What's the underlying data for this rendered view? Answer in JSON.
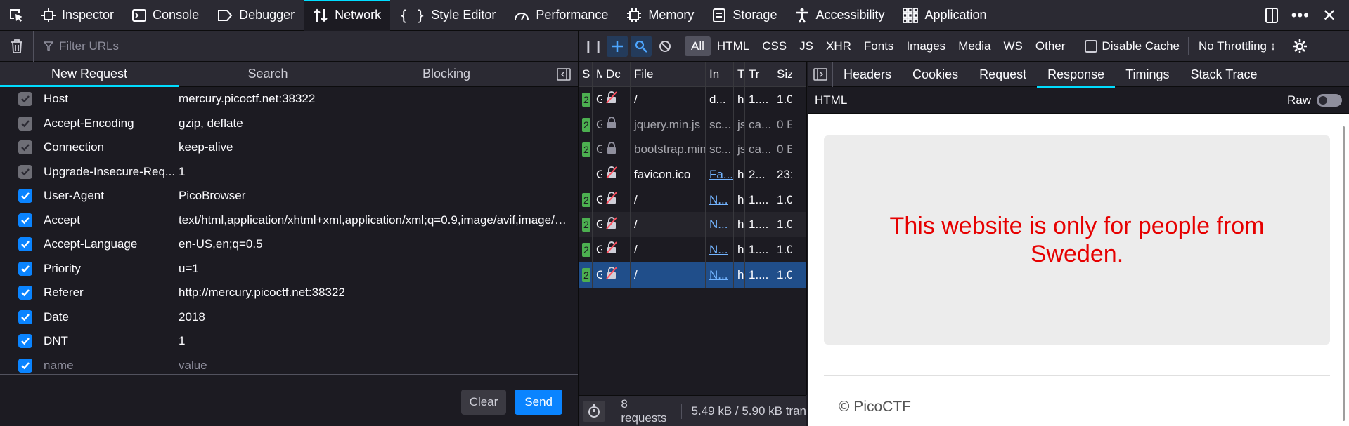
{
  "toolbar": {
    "tabs": [
      {
        "label": "Inspector",
        "icon": "inspector-icon"
      },
      {
        "label": "Console",
        "icon": "console-icon"
      },
      {
        "label": "Debugger",
        "icon": "debugger-icon"
      },
      {
        "label": "Network",
        "icon": "network-icon"
      },
      {
        "label": "Style Editor",
        "icon": "style-editor-icon"
      },
      {
        "label": "Performance",
        "icon": "performance-icon"
      },
      {
        "label": "Memory",
        "icon": "memory-icon"
      },
      {
        "label": "Storage",
        "icon": "storage-icon"
      },
      {
        "label": "Accessibility",
        "icon": "accessibility-icon"
      },
      {
        "label": "Application",
        "icon": "application-icon"
      }
    ],
    "active_tab": "Network",
    "accent": "#00ddff"
  },
  "left": {
    "filter_placeholder": "Filter URLs",
    "subtabs": [
      "New Request",
      "Search",
      "Blocking"
    ],
    "headers": [
      {
        "name": "Host",
        "value": "mercury.picoctf.net:38322",
        "state": "dim"
      },
      {
        "name": "Accept-Encoding",
        "value": "gzip, deflate",
        "state": "dim"
      },
      {
        "name": "Connection",
        "value": "keep-alive",
        "state": "dim"
      },
      {
        "name": "Upgrade-Insecure-Req...",
        "value": "1",
        "state": "dim"
      },
      {
        "name": "User-Agent",
        "value": "PicoBrowser",
        "state": "on"
      },
      {
        "name": "Accept",
        "value": "text/html,application/xhtml+xml,application/xml;q=0.9,image/avif,image/w...",
        "state": "on"
      },
      {
        "name": "Accept-Language",
        "value": "en-US,en;q=0.5",
        "state": "on"
      },
      {
        "name": "Priority",
        "value": "u=1",
        "state": "on"
      },
      {
        "name": "Referer",
        "value": "http://mercury.picoctf.net:38322",
        "state": "on"
      },
      {
        "name": "Date",
        "value": "2018",
        "state": "on"
      },
      {
        "name": "DNT",
        "value": "1",
        "state": "on"
      },
      {
        "name": "name",
        "value": "value",
        "state": "on",
        "placeholder": true
      }
    ],
    "clear_label": "Clear",
    "send_label": "Send"
  },
  "midbar": {
    "types": [
      "All",
      "HTML",
      "CSS",
      "JS",
      "XHR",
      "Fonts",
      "Images",
      "Media",
      "WS",
      "Other"
    ],
    "active_type": "All",
    "disable_cache_label": "Disable Cache",
    "throttling_label": "No Throttling ↕"
  },
  "list": {
    "columns": [
      "S",
      "M",
      "Dc",
      "File",
      "In",
      "T",
      "Tr",
      "Siz"
    ],
    "rows": [
      {
        "status": "2",
        "method": "G",
        "file": "/",
        "init": "d...",
        "type": "ht",
        "transferred": "1....",
        "size": "1.0",
        "style": "normal"
      },
      {
        "status": "2",
        "method": "G",
        "file": "jquery.min.js",
        "init": "sc...",
        "type": "js",
        "transferred": "ca...",
        "size": "0 B",
        "style": "dim"
      },
      {
        "status": "2",
        "method": "G",
        "file": "bootstrap.min",
        "init": "sc...",
        "type": "js",
        "transferred": "ca...",
        "size": "0 B",
        "style": "dim"
      },
      {
        "status": "",
        "method": "G",
        "file": "favicon.ico",
        "init": "Fa...",
        "type": "ht",
        "transferred": "2...",
        "size": "23:",
        "style": "normal"
      },
      {
        "status": "2",
        "method": "G",
        "file": "/",
        "init": "N...",
        "type": "ht",
        "transferred": "1....",
        "size": "1.0",
        "style": "normal"
      },
      {
        "status": "2",
        "method": "G",
        "file": "/",
        "init": "N...",
        "type": "ht",
        "transferred": "1....",
        "size": "1.0",
        "style": "normal"
      },
      {
        "status": "2",
        "method": "G",
        "file": "/",
        "init": "N...",
        "type": "ht",
        "transferred": "1....",
        "size": "1.0",
        "style": "normal"
      },
      {
        "status": "2",
        "method": "G",
        "file": "/",
        "init": "N...",
        "type": "ht",
        "transferred": "1....",
        "size": "1.0",
        "style": "sel"
      }
    ],
    "requests_count": "8 requests",
    "transfer_summary": "5.49 kB / 5.90 kB tran"
  },
  "right": {
    "tabs": [
      "Headers",
      "Cookies",
      "Request",
      "Response",
      "Timings",
      "Stack Trace"
    ],
    "active_tab": "Response",
    "format_label": "HTML",
    "raw_label": "Raw",
    "preview_message": "This website is only for people from Sweden.",
    "preview_footer": "© PicoCTF",
    "message_color": "#e60000"
  }
}
